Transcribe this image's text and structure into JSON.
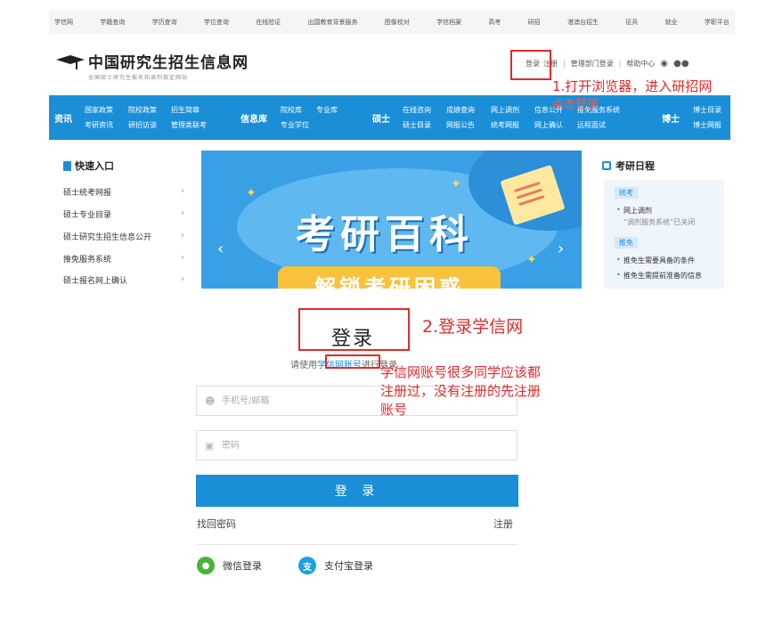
{
  "top_nav": [
    "学信网",
    "学籍查询",
    "学历查询",
    "学位查询",
    "在线验证",
    "出国教育背景服务",
    "图像校对",
    "学信档案",
    "高考",
    "研招",
    "港澳台招生",
    "征兵",
    "就业",
    "学职平台"
  ],
  "header": {
    "logo_title": "中国研究生招生信息网",
    "logo_subtitle": "全国硕士研究生报名和调剂指定网站",
    "login": "登录",
    "register": "注册",
    "admin_login": "管理部门登录",
    "help": "帮助中心",
    "icons": [
      "weibo-icon",
      "wechat-icon"
    ]
  },
  "bluebar": {
    "zixun": {
      "title": "资讯",
      "links": [
        "国家政策",
        "院校政策",
        "招生简章",
        "考研资讯",
        "研招访谈",
        "管理类联考"
      ]
    },
    "xinxiku": {
      "title": "信息库",
      "links": [
        "院校库",
        "专业库",
        "专业学位"
      ]
    },
    "shuoshi": {
      "title": "硕士",
      "links": [
        "在线咨询",
        "成绩查询",
        "网上调剂",
        "信息公开",
        "推免服务系统",
        "硕士目录",
        "网报公告",
        "统考网报",
        "网上确认",
        "远程面试"
      ]
    },
    "boshi": {
      "title": "博士",
      "links": [
        "博士目录",
        "博士网报"
      ]
    }
  },
  "quick_entry": {
    "title": "快速入口",
    "items": [
      "硕士统考网报",
      "硕士专业目录",
      "硕士研究生招生信息公开",
      "推免服务系统",
      "硕士报名网上确认"
    ]
  },
  "banner": {
    "title": "考研百科",
    "subtitle": "解锁考研困惑"
  },
  "schedule": {
    "title": "考研日程",
    "groups": [
      {
        "tag": "统考",
        "items": [
          "网上调剂",
          "“调剂服务系统”已关闭"
        ]
      },
      {
        "tag": "推免",
        "items": [
          "推免生需要具备的条件",
          "推免生需提前准备的信息"
        ]
      }
    ]
  },
  "login_form": {
    "title": "登录",
    "hint_prefix": "请使用",
    "hint_account": "学信网账号",
    "hint_suffix": "进行登录",
    "phone_placeholder": "手机号/邮箱",
    "password_placeholder": "密码",
    "submit": "登 录",
    "forgot": "找回密码",
    "register": "注册",
    "wechat_login": "微信登录",
    "alipay_login": "支付宝登录"
  },
  "annotations": {
    "step1_line1": "1.打开浏览器，进入研招网",
    "step1_line2": "点击登录",
    "step2": "2.登录学信网",
    "note_line1": "学信网账号很多同学应该都",
    "note_line2": "注册过，没有注册的先注册",
    "note_line3": "账号"
  },
  "colors": {
    "brand_blue": "#1a8fd8",
    "annotation_red": "#e02b2b"
  }
}
